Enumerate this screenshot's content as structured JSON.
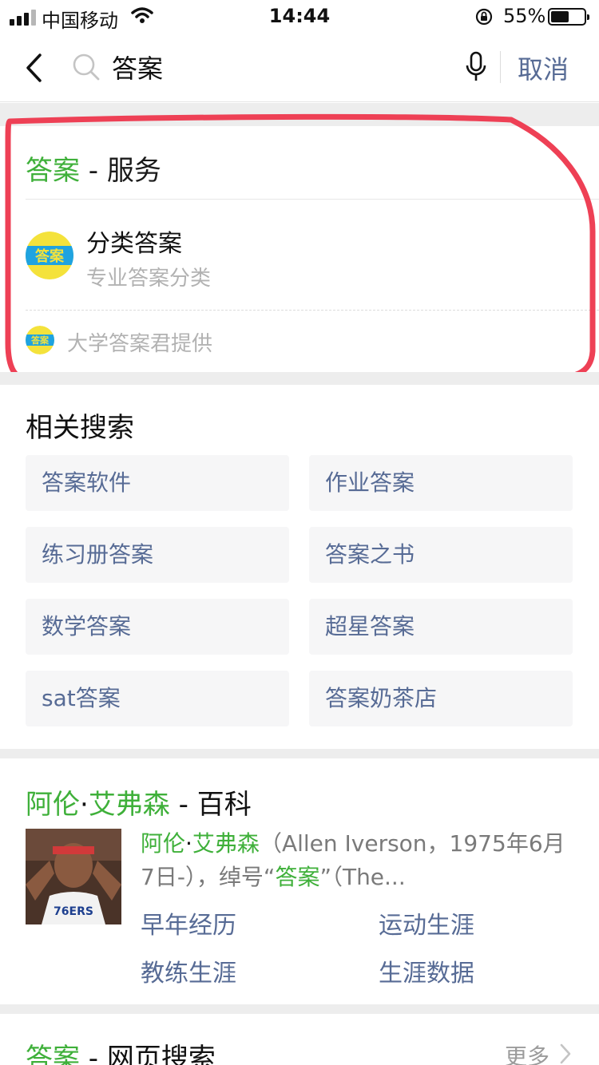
{
  "status_bar": {
    "carrier": "中国移动",
    "time": "14:44",
    "battery_percent": "55%",
    "battery_level": 0.55
  },
  "search": {
    "query": "答案",
    "cancel_label": "取消"
  },
  "service": {
    "keyword": "答案",
    "title_suffix": " - 服务",
    "logo_text": "答案",
    "name": "分类答案",
    "description": "专业答案分类",
    "provider": "大学答案君提供"
  },
  "related": {
    "title": "相关搜索",
    "items": [
      "答案软件",
      "作业答案",
      "练习册答案",
      "答案之书",
      "数学答案",
      "超星答案",
      "sat答案",
      "答案奶茶店"
    ]
  },
  "baike": {
    "name_part1": "阿伦",
    "name_dot": "·",
    "name_part2": "艾弗森",
    "title_suffix": " - 百科",
    "summary": {
      "name_part1": "阿伦",
      "name_dot": "·",
      "name_part2": "艾弗森",
      "text1": "（Allen Iverson，1975年6月7日-），绰号“",
      "keyword": "答案",
      "text2": "”（The..."
    },
    "photo_jersey_text": "76ERS",
    "links": [
      "早年经历",
      "运动生涯",
      "教练生涯",
      "生涯数据"
    ]
  },
  "web_search": {
    "keyword": "答案",
    "title_suffix": " - 网页搜索",
    "more_label": "更多"
  },
  "colors": {
    "highlight": "#3fb03a",
    "link": "#576b95",
    "annotation": "#ee4055"
  }
}
